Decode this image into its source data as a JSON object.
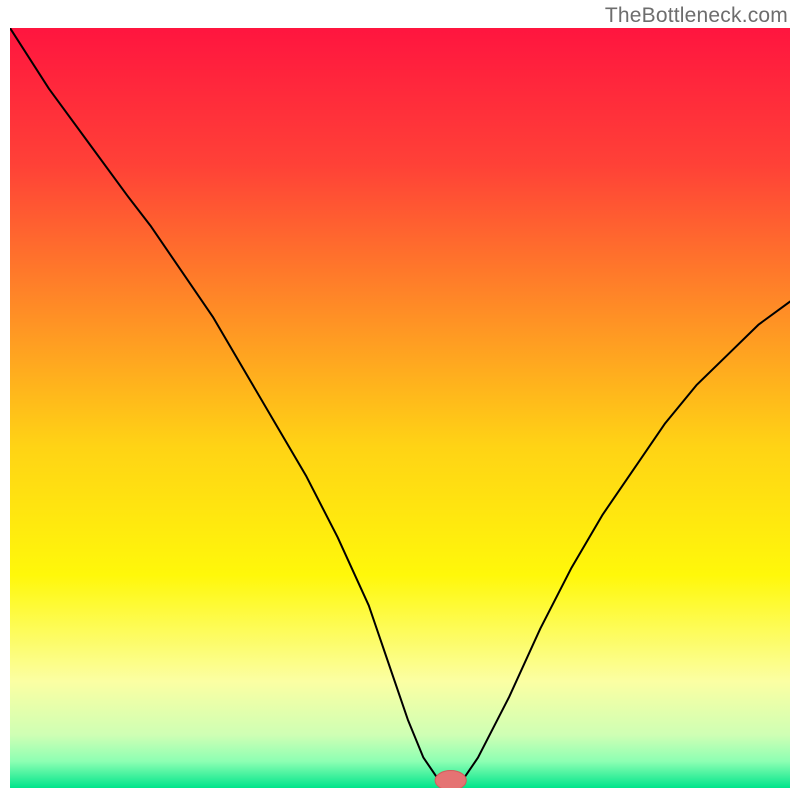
{
  "watermark": "TheBottleneck.com",
  "chart_data": {
    "type": "line",
    "title": "",
    "xlabel": "",
    "ylabel": "",
    "xlim": [
      0,
      100
    ],
    "ylim": [
      0,
      100
    ],
    "legend": false,
    "grid": false,
    "background_gradient": {
      "direction": "vertical",
      "stops": [
        {
          "pos": 0.0,
          "color": "#ff153f"
        },
        {
          "pos": 0.18,
          "color": "#ff4137"
        },
        {
          "pos": 0.38,
          "color": "#ff9025"
        },
        {
          "pos": 0.55,
          "color": "#ffd315"
        },
        {
          "pos": 0.72,
          "color": "#fff80a"
        },
        {
          "pos": 0.86,
          "color": "#fbffa3"
        },
        {
          "pos": 0.93,
          "color": "#cfffb4"
        },
        {
          "pos": 0.965,
          "color": "#8dffb3"
        },
        {
          "pos": 1.0,
          "color": "#00e58b"
        }
      ]
    },
    "series": [
      {
        "name": "bottleneck-curve",
        "color": "#000000",
        "width": 2,
        "x": [
          0,
          5,
          10,
          15,
          18,
          22,
          26,
          30,
          34,
          38,
          42,
          46,
          49,
          51,
          53,
          55,
          57,
          58,
          60,
          64,
          68,
          72,
          76,
          80,
          84,
          88,
          92,
          96,
          100
        ],
        "y": [
          100,
          92,
          85,
          78,
          74,
          68,
          62,
          55,
          48,
          41,
          33,
          24,
          15,
          9,
          4,
          1,
          1,
          1,
          4,
          12,
          21,
          29,
          36,
          42,
          48,
          53,
          57,
          61,
          64
        ]
      }
    ],
    "marker": {
      "name": "optimum-marker",
      "x": 56.5,
      "y": 1,
      "rx": 2.0,
      "ry": 1.3,
      "fill": "#e57373",
      "stroke": "#d35b5b"
    }
  }
}
